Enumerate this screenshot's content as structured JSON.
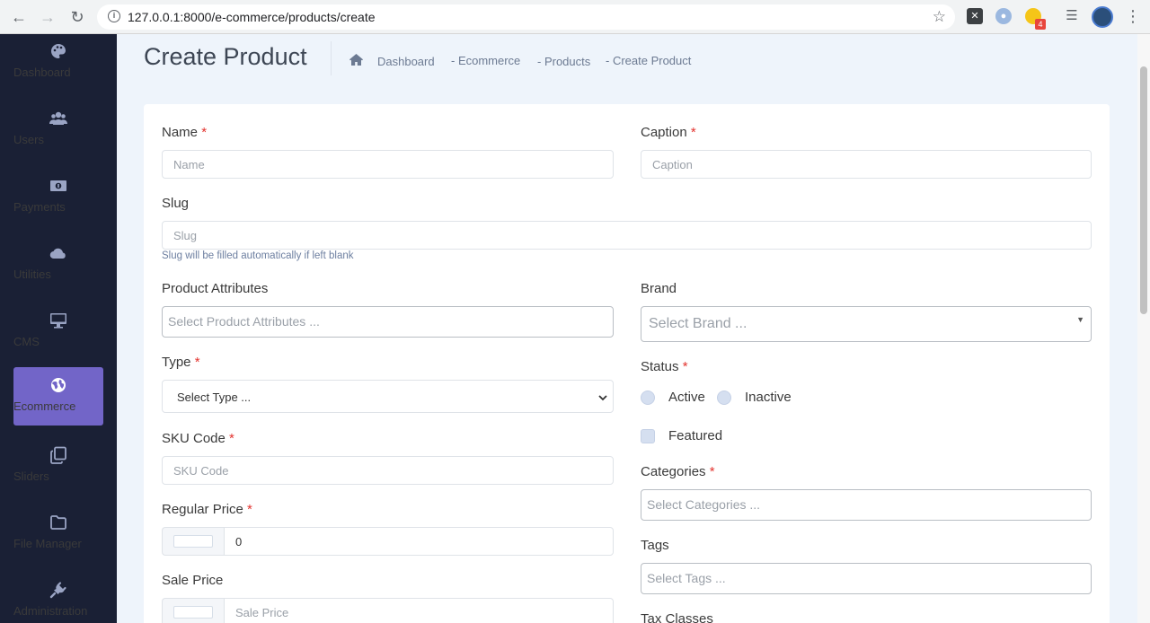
{
  "browser": {
    "url": "127.0.0.1:8000/e-commerce/products/create",
    "extension_badge": "4"
  },
  "sidebar": {
    "items": [
      {
        "label": "Dashboard",
        "icon": "palette-icon"
      },
      {
        "label": "Users",
        "icon": "users-icon"
      },
      {
        "label": "Payments",
        "icon": "money-bill-icon"
      },
      {
        "label": "Utilities",
        "icon": "cloud-icon"
      },
      {
        "label": "CMS",
        "icon": "desktop-icon"
      },
      {
        "label": "Ecommerce",
        "icon": "globe-icon",
        "active": true
      },
      {
        "label": "Sliders",
        "icon": "copy-icon"
      },
      {
        "label": "File Manager",
        "icon": "folder-icon"
      },
      {
        "label": "Administration",
        "icon": "plug-icon"
      }
    ]
  },
  "header": {
    "title": "Create Product",
    "breadcrumb": [
      "Dashboard",
      "- Ecommerce",
      "- Products",
      "- Create Product"
    ]
  },
  "form": {
    "name": {
      "label": "Name",
      "required": "*",
      "placeholder": "Name"
    },
    "caption": {
      "label": "Caption",
      "required": "*",
      "placeholder": "Caption"
    },
    "slug": {
      "label": "Slug",
      "placeholder": "Slug",
      "help": "Slug will be filled automatically if left blank"
    },
    "product_attributes": {
      "label": "Product Attributes",
      "placeholder": "Select Product Attributes ..."
    },
    "brand": {
      "label": "Brand",
      "placeholder": "Select Brand ..."
    },
    "type": {
      "label": "Type",
      "required": "*",
      "placeholder": "Select Type ..."
    },
    "status": {
      "label": "Status",
      "required": "*",
      "options": [
        "Active",
        "Inactive"
      ]
    },
    "featured": {
      "label": "Featured"
    },
    "sku": {
      "label": "SKU Code",
      "required": "*",
      "placeholder": "SKU Code"
    },
    "categories": {
      "label": "Categories",
      "required": "*",
      "placeholder": "Select Categories ..."
    },
    "regular_price": {
      "label": "Regular Price",
      "required": "*",
      "value": "0"
    },
    "tags": {
      "label": "Tags",
      "placeholder": "Select Tags ..."
    },
    "sale_price": {
      "label": "Sale Price",
      "placeholder": "Sale Price"
    },
    "tax_classes": {
      "label": "Tax Classes"
    }
  },
  "colors": {
    "sidebar_bg": "#1a2035",
    "active_item": "#7265c8",
    "required": "#e3342f"
  }
}
